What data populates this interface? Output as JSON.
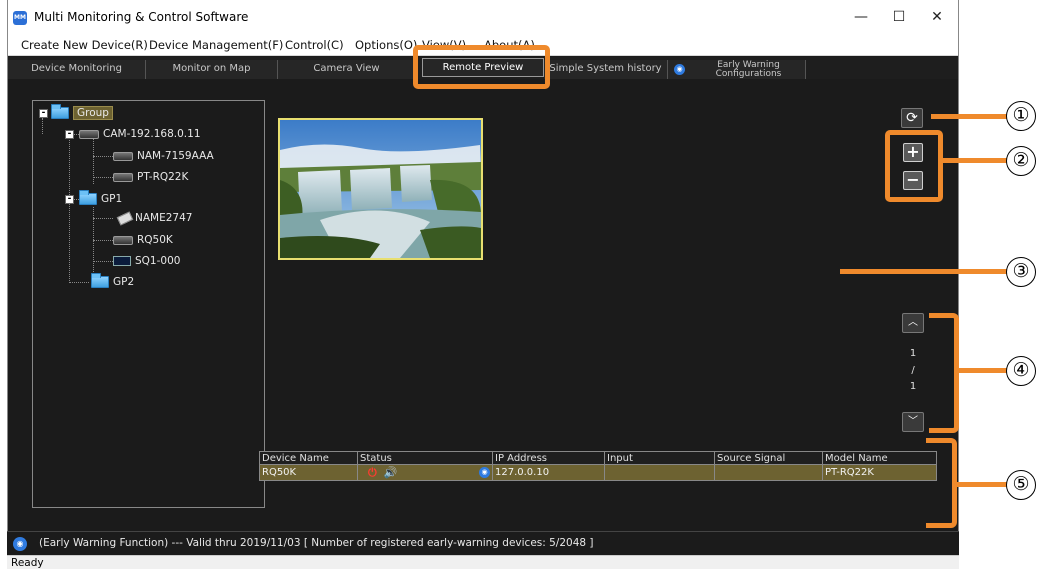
{
  "window": {
    "title": "Multi Monitoring & Control Software",
    "app_icon_text": "MM",
    "minimize": "—",
    "maximize": "☐",
    "close": "✕"
  },
  "menu": [
    {
      "label": "Create New Device(R)"
    },
    {
      "label": "Device Management(F)"
    },
    {
      "label": "Control(C)"
    },
    {
      "label": "Options(O)"
    },
    {
      "label": "View(V)"
    },
    {
      "label": "About(A)"
    }
  ],
  "tabs": [
    {
      "label": "Device Monitoring"
    },
    {
      "label": "Monitor on Map"
    },
    {
      "label": "Camera View"
    },
    {
      "label": "Remote Preview",
      "active": true
    },
    {
      "label": "Simple System history"
    },
    {
      "label": "Early Warning\nConfigurations"
    }
  ],
  "tree": {
    "root": "Group",
    "nodes": [
      {
        "label": "CAM-192.168.0.11"
      },
      {
        "label": "NAM-7159AAA"
      },
      {
        "label": "PT-RQ22K"
      },
      {
        "label": "GP1"
      },
      {
        "label": "NAME2747"
      },
      {
        "label": "RQ50K"
      },
      {
        "label": "SQ1-000"
      },
      {
        "label": "GP2"
      }
    ]
  },
  "controls": {
    "refresh": "⟳",
    "zoom_in": "+",
    "zoom_out": "−",
    "page_up": "︿",
    "page_down": "﹀",
    "page_current": "1",
    "page_sep": "/",
    "page_total": "1"
  },
  "table": {
    "headers": [
      "Device Name",
      "Status",
      "IP Address",
      "Input",
      "Source Signal",
      "Model Name"
    ],
    "rows": [
      {
        "device_name": "RQ50K",
        "ip_address": "127.0.0.10",
        "input": "",
        "source_signal": "",
        "model_name": "PT-RQ22K"
      }
    ]
  },
  "status": {
    "early_warning": "(Early Warning Function) --- Valid thru 2019/11/03  [ Number of registered early-warning devices: 5/2048 ]",
    "ready": "Ready"
  },
  "callouts": [
    "①",
    "②",
    "③",
    "④",
    "⑤"
  ],
  "colors": {
    "callout_orange": "#ef8a2c",
    "selection_olive": "#6d6231",
    "thumbnail_border": "#e8df70",
    "background": "#1b1b1b"
  }
}
